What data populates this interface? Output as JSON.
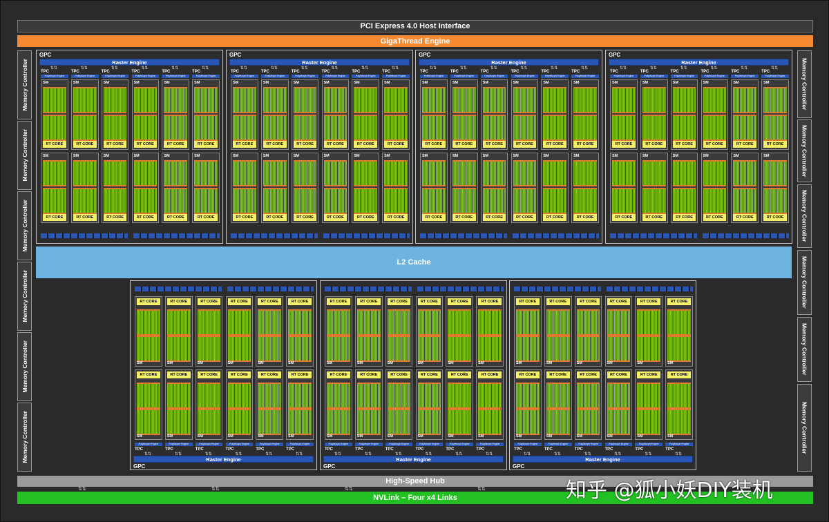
{
  "chip": {
    "pcie": "PCI Express 4.0 Host Interface",
    "giga_thread": "GigaThread Engine",
    "l2_cache": "L2 Cache",
    "high_speed_hub": "High-Speed Hub",
    "nvlink": "NVLink – Four x4 Links"
  },
  "memory_controller_label": "Memory Controller",
  "gpc_label": "GPC",
  "raster_engine_label": "Raster Engine",
  "tpc_label": "TPC",
  "polymorph_label": "PolyMorph Engine",
  "sm_label": "SM",
  "rt_core_label": "RT CORE",
  "watermark": "知乎 @狐小妖DIY装机",
  "colors": {
    "pcie": "#3a3a3a",
    "giga_thread": "#f58a33",
    "l2_cache": "#6fb4e0",
    "raster": "#2a56b8",
    "cuda_core": "#7fc21c",
    "rt_core": "#f5f06a",
    "nvlink": "#22c022",
    "hub": "#9a9a9a"
  }
}
